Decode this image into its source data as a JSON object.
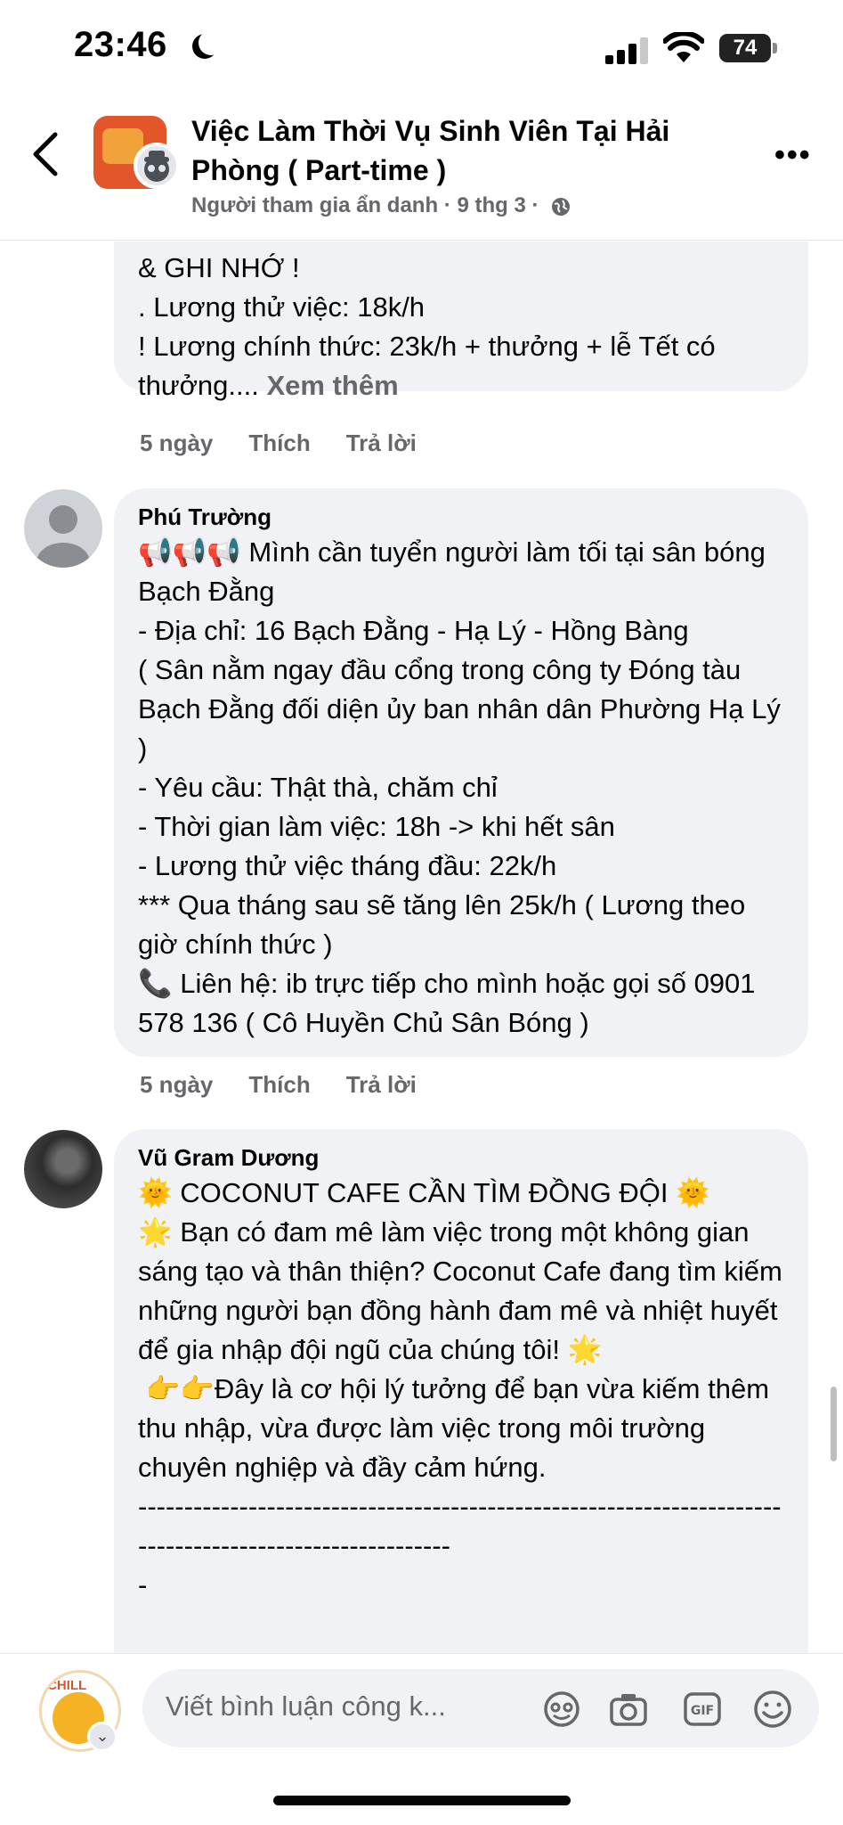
{
  "status_bar": {
    "time": "23:46",
    "battery": "74"
  },
  "header": {
    "title": "Việc Làm Thời Vụ Sinh Viên Tại Hải Phòng ( Part-time )",
    "meta": "Người tham gia ẩn danh · 9 thg 3 ·",
    "icons": {
      "back": "chevron-left-icon",
      "more": "more-horizontal-icon",
      "privacy": "globe-icon"
    }
  },
  "comments": [
    {
      "text": "& GHI NHỚ !\n. Lương thử việc: 18k/h\n! Lương chính thức: 23k/h + thưởng + lễ Tết có thưởng....",
      "see_more": "Xem thêm",
      "time": "5 ngày",
      "like": "Thích",
      "reply": "Trả lời"
    },
    {
      "author": "Phú Trường",
      "text": "📢📢📢 Mình cần tuyển người làm tối tại sân bóng Bạch Đằng\n- Địa chỉ: 16 Bạch Đằng - Hạ Lý - Hồng Bàng\n( Sân nằm ngay đầu cổng trong công ty Đóng tàu Bạch Đằng đối diện ủy ban nhân dân Phường Hạ Lý )\n- Yêu cầu: Thật thà, chăm chỉ\n- Thời gian làm việc: 18h -> khi hết sân\n- Lương thử việc tháng đầu: 22k/h\n*** Qua tháng sau sẽ tăng lên 25k/h ( Lương theo giờ chính thức )\n📞 Liên hệ: ib trực tiếp cho mình hoặc gọi số 0901 578 136 ( Cô Huyền Chủ Sân Bóng )",
      "time": "5 ngày",
      "like": "Thích",
      "reply": "Trả lời"
    },
    {
      "author": "Vũ Gram Dương",
      "text": "🌞 COCONUT CAFE CẦN TÌM ĐỒNG ĐỘI 🌞\n🌟 Bạn có đam mê làm việc trong một không gian sáng tạo và thân thiện? Coconut Cafe đang tìm kiếm những người bạn đồng hành đam mê và nhiệt huyết để gia nhập đội ngũ của chúng tôi! 🌟\n 👉👉Đây là cơ hội lý tưởng để bạn vừa kiếm thêm thu nhập, vừa được làm việc trong môi trường chuyên nghiệp và đầy cảm hứng.\n--------------------------------------------------------------------------------------------------------\n-"
    }
  ],
  "composer": {
    "placeholder": "Viết bình luận công k...",
    "avatar_text": "CHILL",
    "icons": [
      "sticker-icon",
      "camera-icon",
      "gif-icon",
      "emoji-icon"
    ]
  }
}
